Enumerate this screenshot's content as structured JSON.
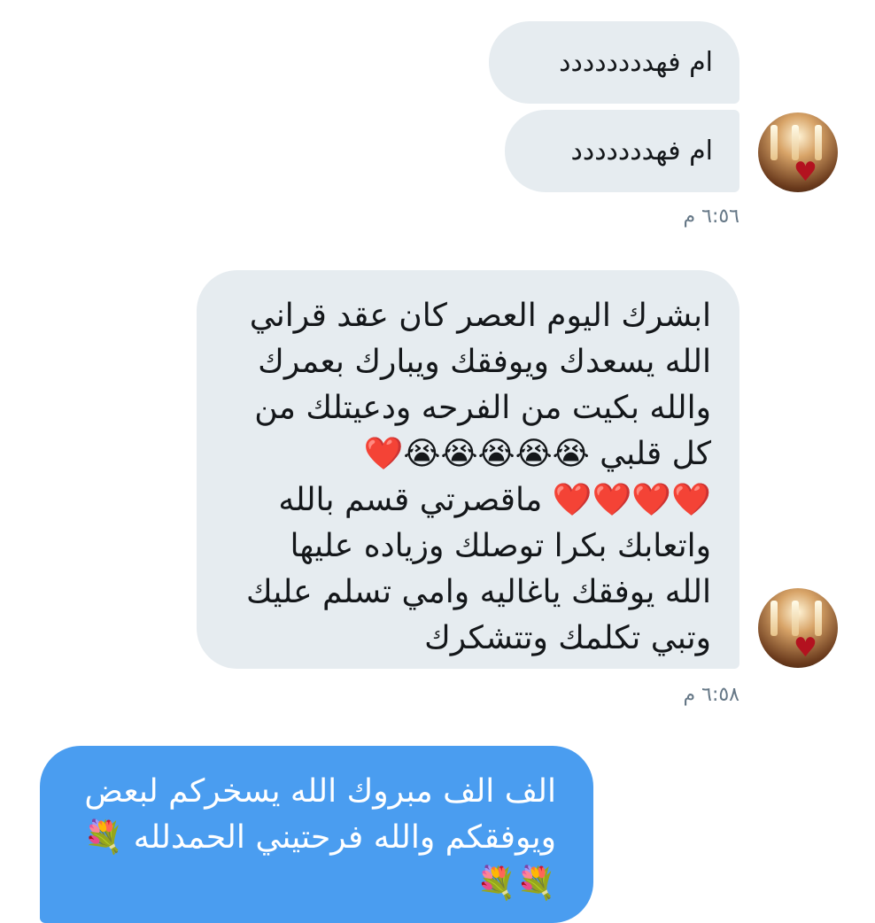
{
  "messages": [
    {
      "text_lines": [
        "ام فهدددددددد"
      ]
    },
    {
      "text_lines": [
        "ام فهددددددد"
      ]
    },
    {
      "text_lines": [
        "ابشرك اليوم العصر  كان عقد قراني",
        "الله يسعدك ويوفقك ويبارك بعمرك",
        "والله بكيت من الفرحه ودعيتلك من",
        "كل قلبي 😭😭😭😭😭❤️",
        "❤️❤️❤️❤️ ماقصرتي قسم بالله",
        "واتعابك بكرا  توصلك وزياده عليها",
        "الله يوفقك ياغاليه وامي تسلم عليك",
        "وتبي تكلمك وتتشكرك"
      ]
    },
    {
      "text_lines": [
        "الف الف مبروك الله يسخركم لبعض",
        "ويوفقكم والله فرحتيني الحمدلله 💐",
        "💐💐"
      ]
    }
  ],
  "timestamps": [
    "٦:٥٦ م",
    "٦:٥٨ م"
  ],
  "avatar": {
    "icon": "heart-candles-avatar"
  },
  "colors": {
    "incoming_bubble": "#e6ecf0",
    "outgoing_bubble": "#4a9df0",
    "timestamp": "#657786"
  }
}
